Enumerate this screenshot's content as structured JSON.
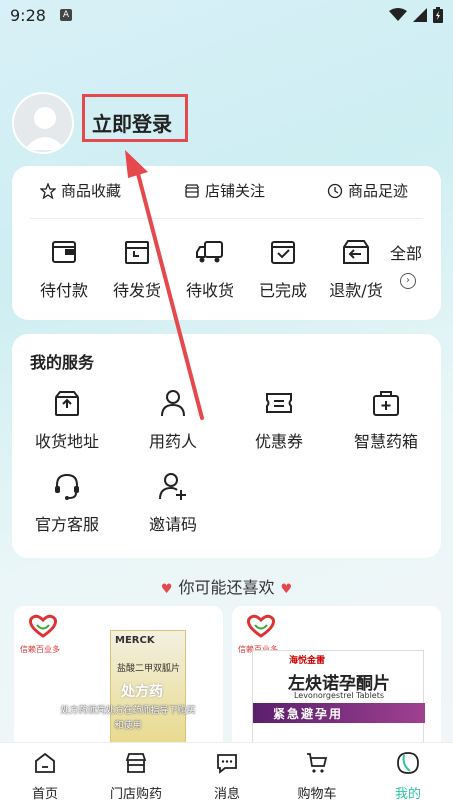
{
  "status_bar": {
    "time": "9:28",
    "notif_icon": "A"
  },
  "profile": {
    "login_label": "立即登录"
  },
  "favorites": [
    {
      "label": "商品收藏",
      "icon": "star-icon"
    },
    {
      "label": "店铺关注",
      "icon": "store-icon"
    },
    {
      "label": "商品足迹",
      "icon": "clock-icon"
    }
  ],
  "orders": {
    "items": [
      {
        "label": "待付款",
        "icon": "wallet-icon"
      },
      {
        "label": "待发货",
        "icon": "package-icon"
      },
      {
        "label": "待收货",
        "icon": "truck-icon"
      },
      {
        "label": "已完成",
        "icon": "check-box-icon"
      },
      {
        "label": "退款/货",
        "icon": "return-icon"
      }
    ],
    "all_label": "全部"
  },
  "services": {
    "title": "我的服务",
    "items": [
      {
        "label": "收货地址",
        "icon": "address-box-icon"
      },
      {
        "label": "用药人",
        "icon": "user-icon"
      },
      {
        "label": "优惠券",
        "icon": "coupon-icon"
      },
      {
        "label": "智慧药箱",
        "icon": "medicine-kit-icon"
      },
      {
        "label": "官方客服",
        "icon": "headset-icon"
      },
      {
        "label": "邀请码",
        "icon": "add-user-icon"
      }
    ]
  },
  "recommend": {
    "title": "你可能还喜欢",
    "products": [
      {
        "brand": "MERCK",
        "logo_text": "信赖百业多",
        "box_text": "盐酸二甲双胍片",
        "rx_label": "处方药",
        "note": "处方药须凭处方在药师指导下购买和使用"
      },
      {
        "logo_text": "信赖百业多",
        "maker": "海悦金雷",
        "name": "左炔诺孕酮片",
        "name_en": "Levonorgestrel Tablets",
        "band": "紧急避孕用"
      }
    ]
  },
  "tabbar": [
    {
      "label": "首页",
      "icon": "home-icon",
      "active": false
    },
    {
      "label": "门店购药",
      "icon": "shop-icon",
      "active": false
    },
    {
      "label": "消息",
      "icon": "message-icon",
      "active": false
    },
    {
      "label": "购物车",
      "icon": "cart-icon",
      "active": false
    },
    {
      "label": "我的",
      "icon": "mine-icon",
      "active": true
    }
  ],
  "colors": {
    "accent": "#2ec4a8",
    "highlight": "#e5484d"
  }
}
